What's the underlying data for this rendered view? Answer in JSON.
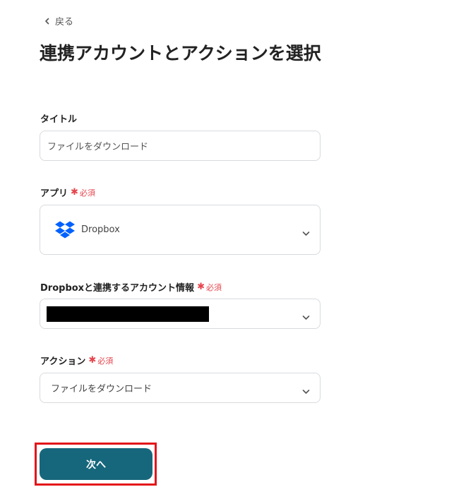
{
  "header": {
    "back_label": "戻る",
    "title": "連携アカウントとアクションを選択"
  },
  "form": {
    "required_label": "必須",
    "title_field": {
      "label": "タイトル",
      "value": "ファイルをダウンロード"
    },
    "app_field": {
      "label": "アプリ",
      "selected": "Dropbox",
      "icon": "dropbox-logo"
    },
    "account_field": {
      "label": "Dropboxと連携するアカウント情報",
      "value_redacted": true
    },
    "action_field": {
      "label": "アクション",
      "selected": "ファイルをダウンロード"
    }
  },
  "footer": {
    "next_label": "次へ"
  },
  "colors": {
    "primary_button": "#16677c",
    "required": "#e5454d",
    "highlight": "#e3141a",
    "dropbox_blue": "#0061fe"
  }
}
